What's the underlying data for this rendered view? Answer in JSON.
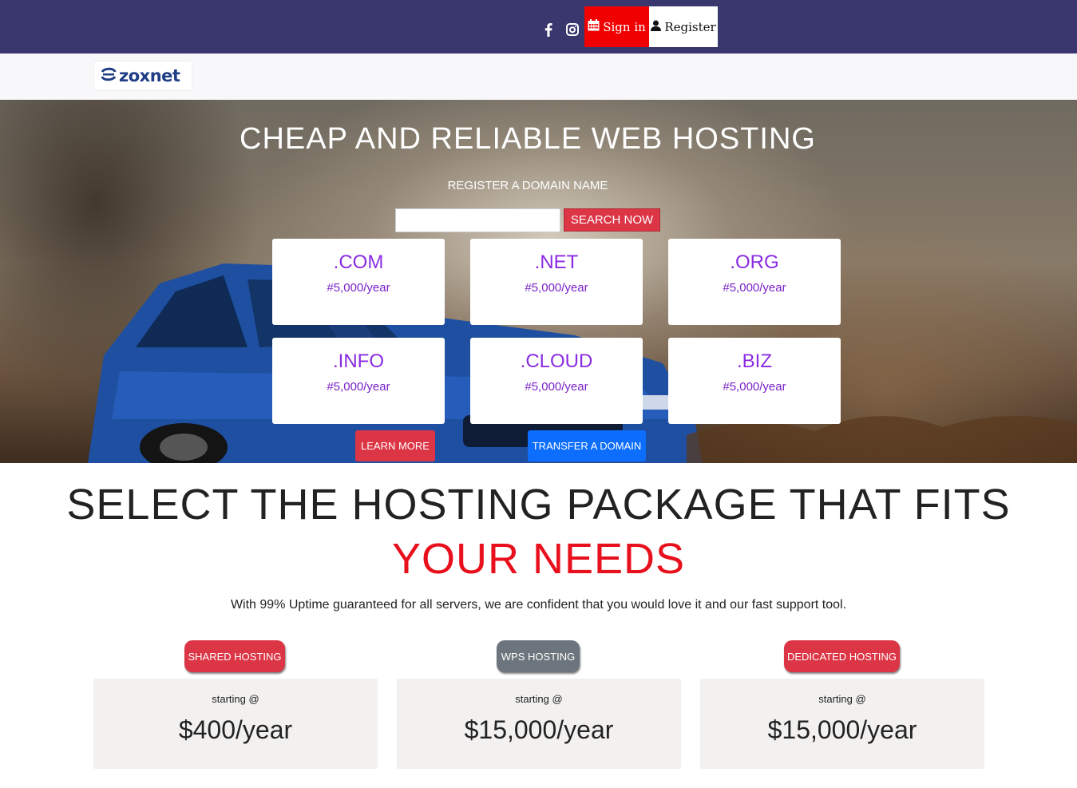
{
  "topbar": {
    "social_icons": [
      "facebook-icon",
      "instagram-icon"
    ],
    "signin_label": "Sign in",
    "signin_icon": "calendar-icon",
    "register_label": "Register",
    "register_icon": "user-icon",
    "colors": {
      "bar": "#3a376f",
      "signin_bg": "#f00000",
      "register_bg": "#ffffff"
    }
  },
  "navbar": {
    "logo_text": "zoxnet"
  },
  "hero": {
    "title": "CHEAP AND RELIABLE WEB HOSTING",
    "subtitle": "REGISTER A DOMAIN NAME",
    "search_input_value": "",
    "search_button": "SEARCH NOW",
    "domains": [
      {
        "tld": ".COM",
        "price": "#5,000/year"
      },
      {
        "tld": ".NET",
        "price": "#5,000/year"
      },
      {
        "tld": ".ORG",
        "price": "#5,000/year"
      },
      {
        "tld": ".INFO",
        "price": "#5,000/year"
      },
      {
        "tld": ".CLOUD",
        "price": "#5,000/year"
      },
      {
        "tld": ".BIZ",
        "price": "#5,000/year"
      }
    ],
    "learn_more": "LEARN MORE",
    "transfer_domain": "TRANSFER A DOMAIN"
  },
  "packages_section": {
    "title_line1": "SELECT THE HOSTING PACKAGE THAT FITS",
    "title_line2": "YOUR NEEDS",
    "description": "With 99% Uptime guaranteed for all servers, we are confident that you would love it and our fast support tool.",
    "packages": [
      {
        "label": "SHARED HOSTING",
        "starting": "starting @",
        "price": "$400/year",
        "color": "#dc3545"
      },
      {
        "label": "WPS HOSTING",
        "starting": "starting @",
        "price": "$15,000/year",
        "color": "#6c757d"
      },
      {
        "label": "DEDICATED HOSTING",
        "starting": "starting @",
        "price": "$15,000/year",
        "color": "#dc3545"
      }
    ]
  }
}
